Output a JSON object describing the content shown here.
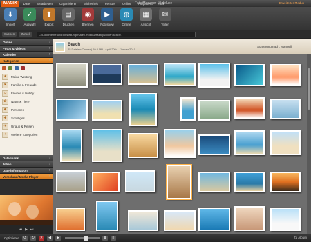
{
  "window": {
    "logo": "MAGIX",
    "title": "Foto Manager 10 deluxe",
    "mode": "Erweiterter Modus",
    "menu": [
      "Datei",
      "Bearbeiten",
      "Organisieren",
      "Sicherheit",
      "Fenster",
      "Online",
      "Aufgaben",
      "Hilfe"
    ]
  },
  "toolbar": {
    "buttons": [
      {
        "label": "Import",
        "icon": "import-icon",
        "color": "#4a7fb5"
      },
      {
        "label": "Auswahl",
        "icon": "select-icon",
        "color": "#3a8a5a"
      },
      {
        "label": "Export",
        "icon": "export-icon",
        "color": "#c0772a"
      },
      {
        "label": "Drucken",
        "icon": "print-icon",
        "color": "#666666"
      },
      {
        "label": "Brennen",
        "icon": "burn-icon",
        "color": "#a33a3a"
      },
      {
        "label": "Fotoshow",
        "icon": "slideshow-icon",
        "color": "#2f5f8f"
      },
      {
        "label": "Online",
        "icon": "online-icon",
        "color": "#2a8ab5"
      },
      {
        "label": "Ansicht",
        "icon": "view-icon",
        "color": "#707070"
      },
      {
        "label": "Teilen",
        "icon": "share-icon",
        "color": "#5a5a5a"
      }
    ]
  },
  "pathbar": {
    "back_label": "Suchen",
    "up_label": "Zurück",
    "path": "C:\\Dokumente und Einstellungen\\alex.mokic\\Desktop\\Bilder\\Beach\\"
  },
  "sidebar": {
    "sections": [
      "Online",
      "Fotos & Videos",
      "Kalender",
      "Kategorien"
    ],
    "categories": [
      "Meine Wertung",
      "Familie & Freunde",
      "Freizeit & Hobby",
      "Natur & Tiere",
      "Personen",
      "Sonstiges",
      "Urlaub & Reisen",
      "Weitere Kategorien"
    ],
    "lower_sections": [
      "Datenbank",
      "Alben",
      "Dateiinformation",
      "Vorschau / Media Player"
    ]
  },
  "content": {
    "folder_title": "Beach",
    "folder_meta": "45 Dateien/Ordner | 69.0 MB | April 2004 - Januar 2010",
    "sort_label": "Sortierung nach: Manuell"
  },
  "bottombar": {
    "optimize_label": "Optimieren",
    "album_label": "Zu Album"
  },
  "colors": {
    "accent": "#e08a2a",
    "grid_bg": "#6e6e6e"
  }
}
